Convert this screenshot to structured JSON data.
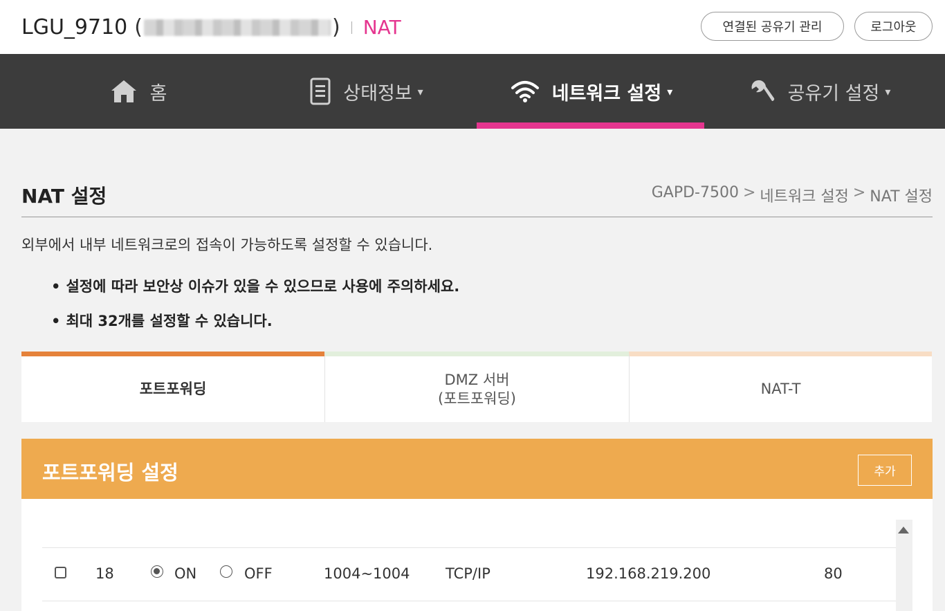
{
  "header": {
    "ssid": "LGU_9710",
    "open_paren": "(",
    "close_paren": ")",
    "page_name": "NAT",
    "connected_routers_button": "연결된 공유기 관리",
    "logout_button": "로그아웃"
  },
  "nav": {
    "items": [
      {
        "label": "홈",
        "icon": "home-icon",
        "has_caret": false
      },
      {
        "label": "상태정보",
        "icon": "document-icon",
        "has_caret": true
      },
      {
        "label": "네트워크 설정",
        "icon": "wifi-icon",
        "has_caret": true,
        "active": true
      },
      {
        "label": "공유기 설정",
        "icon": "wrench-icon",
        "has_caret": true
      }
    ],
    "caret": "▾",
    "active_color": "#e5358f"
  },
  "page": {
    "title": "NAT 설정",
    "breadcrumb": [
      "GAPD-7500",
      "네트워크 설정",
      "NAT 설정"
    ],
    "breadcrumb_sep": ">",
    "description": "외부에서 내부 네트워크로의 접속이 가능하도록 설정할 수 있습니다.",
    "notes": [
      "설정에 따라 보안상 이슈가 있을 수 있으므로 사용에 주의하세요.",
      "최대 32개를 설정할 수 있습니다."
    ],
    "bullet": "•"
  },
  "tabs": [
    {
      "label_line1": "포트포워딩",
      "label_line2": "",
      "active": true,
      "color": "#e5823a"
    },
    {
      "label_line1": "DMZ 서버",
      "label_line2": "(포트포워딩)",
      "active": false,
      "color": "#e2efdc"
    },
    {
      "label_line1": "NAT-T",
      "label_line2": "",
      "active": false,
      "color": "#f8ddc4"
    }
  ],
  "section": {
    "title": "포트포워딩 설정",
    "add_button": "추가",
    "header_color": "#eeaa4f"
  },
  "rows": [
    {
      "checked": false,
      "index": "18",
      "state": "ON",
      "on_label": "ON",
      "off_label": "OFF",
      "port_range": "1004~1004",
      "protocol": "TCP/IP",
      "ip": "192.168.219.200",
      "internal_port": "80"
    }
  ]
}
